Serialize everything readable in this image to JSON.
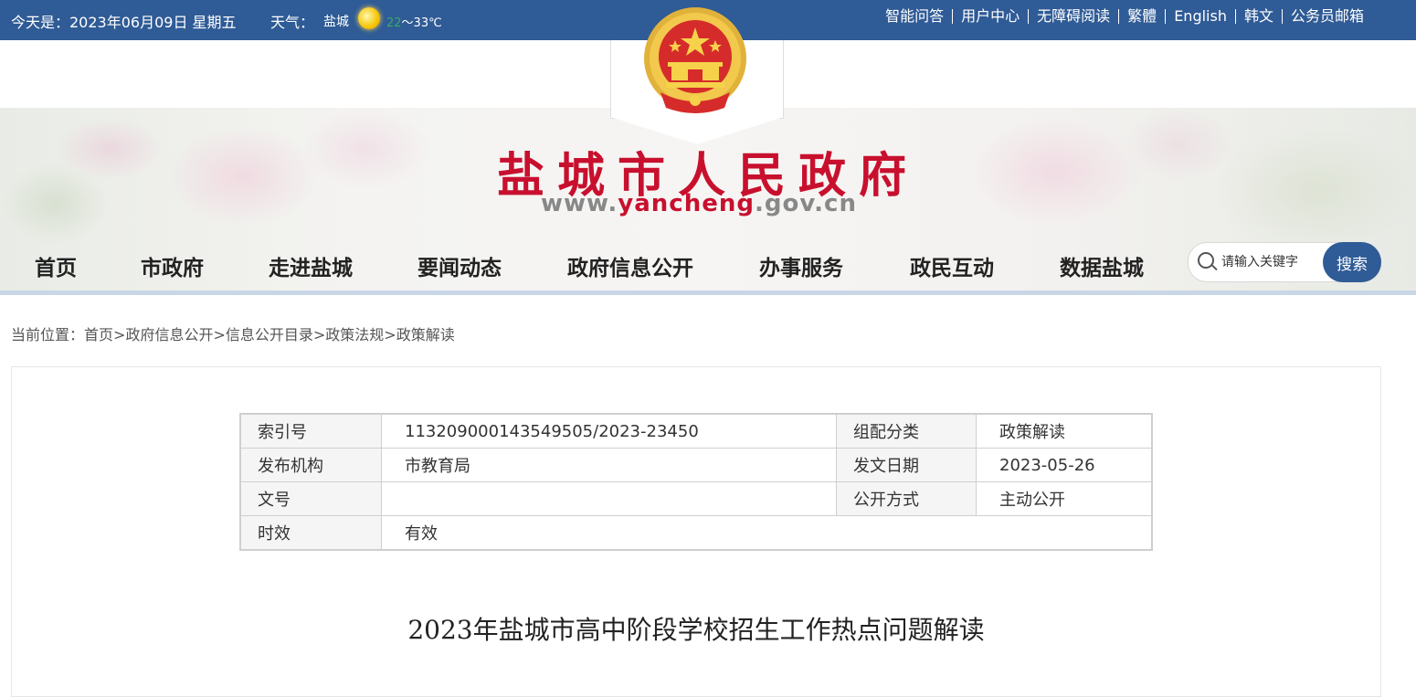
{
  "topbar": {
    "date": "今天是：2023年06月09日 星期五",
    "weather_label": "天气：",
    "city": "盐城",
    "temp_low": "22",
    "temp_high": "～33℃",
    "links": [
      "智能问答",
      "用户中心",
      "无障碍阅读",
      "繁體",
      "English",
      "韩文",
      "公务员邮箱"
    ]
  },
  "header": {
    "title": "盐城市人民政府",
    "url_prefix": "www.",
    "url_mid": "yancheng",
    "url_suffix": ".gov.cn",
    "emblem_icon": "national-emblem-icon"
  },
  "nav": {
    "items": [
      "首页",
      "市政府",
      "走进盐城",
      "要闻动态",
      "政府信息公开",
      "办事服务",
      "政民互动",
      "数据盐城"
    ]
  },
  "search": {
    "placeholder": "请输入关键字",
    "button": "搜索"
  },
  "breadcrumb": {
    "prefix": "当前位置：",
    "items": [
      "首页",
      "政府信息公开",
      "信息公开目录",
      "政策法规",
      "政策解读"
    ]
  },
  "meta": {
    "index_label": "索引号",
    "index_value": "113209000143549505/2023-23450",
    "category_label": "组配分类",
    "category_value": "政策解读",
    "publisher_label": "发布机构",
    "publisher_value": "市教育局",
    "date_label": "发文日期",
    "date_value": "2023-05-26",
    "docno_label": "文号",
    "docno_value": "",
    "open_label": "公开方式",
    "open_value": "主动公开",
    "validity_label": "时效",
    "validity_value": "有效"
  },
  "document": {
    "title": "2023年盐城市高中阶段学校招生工作热点问题解读"
  },
  "colors": {
    "topbar": "#2f5b96",
    "title_red": "#c8102e",
    "search_button": "#2f5b96"
  }
}
